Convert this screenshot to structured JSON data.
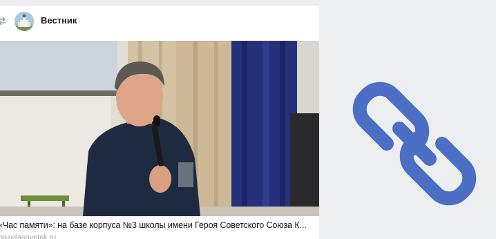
{
  "post": {
    "author": "Вестник",
    "attachment": {
      "title": "«Час памяти»: на базе корпуса №3 школы имени Героя Советского Союза К...",
      "domain": "gazetasovetsk.ru"
    }
  },
  "icons": {
    "repost": "repost-arrow-icon",
    "avatar": "church-avatar",
    "link": "link-chain-icon"
  },
  "colors": {
    "background": "#edeef0",
    "card": "#ffffff",
    "link_icon": "#4a6fc4",
    "domain_text": "#9aa0a6"
  }
}
